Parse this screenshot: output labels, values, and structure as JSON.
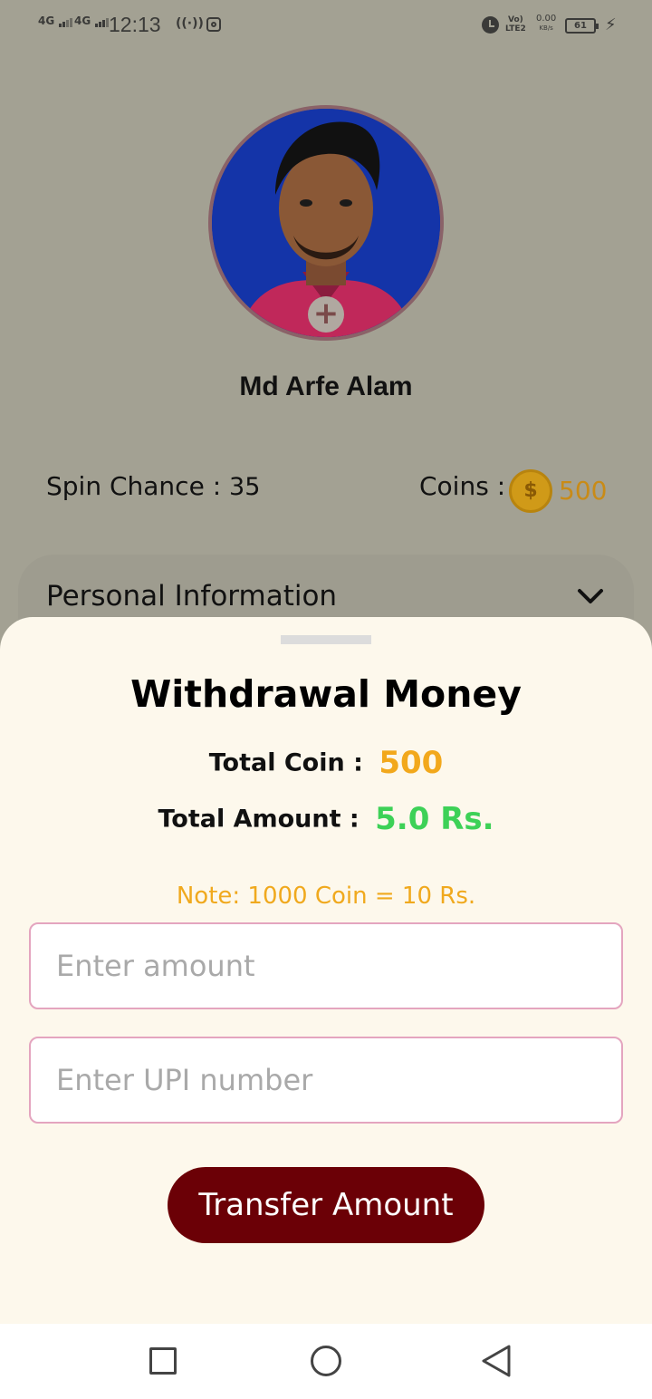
{
  "status_bar": {
    "signal_1": "4G",
    "signal_2": "4G",
    "time": "12:13",
    "volte_top": "Vo)",
    "volte_bottom": "LTE2",
    "speed_value": "0.00",
    "speed_unit": "KB/s",
    "battery": "61"
  },
  "profile": {
    "name": "Md Arfe Alam",
    "spin_label": "Spin Chance : ",
    "spin_value": "35",
    "coins_label": "Coins :",
    "coins_value": "500",
    "coin_symbol": "$"
  },
  "personal_info": {
    "label": "Personal Information"
  },
  "withdrawal": {
    "title": "Withdrawal Money",
    "total_coin_label": "Total Coin : ",
    "total_coin_value": "500",
    "total_amount_label": "Total Amount : ",
    "total_amount_value": "5.0 Rs.",
    "note": "Note: 1000 Coin = 10 Rs.",
    "amount_placeholder": "Enter amount",
    "upi_placeholder": "Enter UPI number",
    "transfer_label": "Transfer Amount"
  },
  "colors": {
    "backdrop": "#a3a193",
    "sheet": "#fdf8ec",
    "coin_value": "#f2a81c",
    "amount_value": "#3dd157",
    "note": "#f0a91e",
    "field_border": "#e4a5bf",
    "button": "#6b0006"
  },
  "icons": {
    "avatar_add": "plus-icon",
    "coin": "coin-icon",
    "chevron": "chevron-down-icon",
    "nav_recent": "square-icon",
    "nav_home": "circle-icon",
    "nav_back": "triangle-back-icon"
  }
}
